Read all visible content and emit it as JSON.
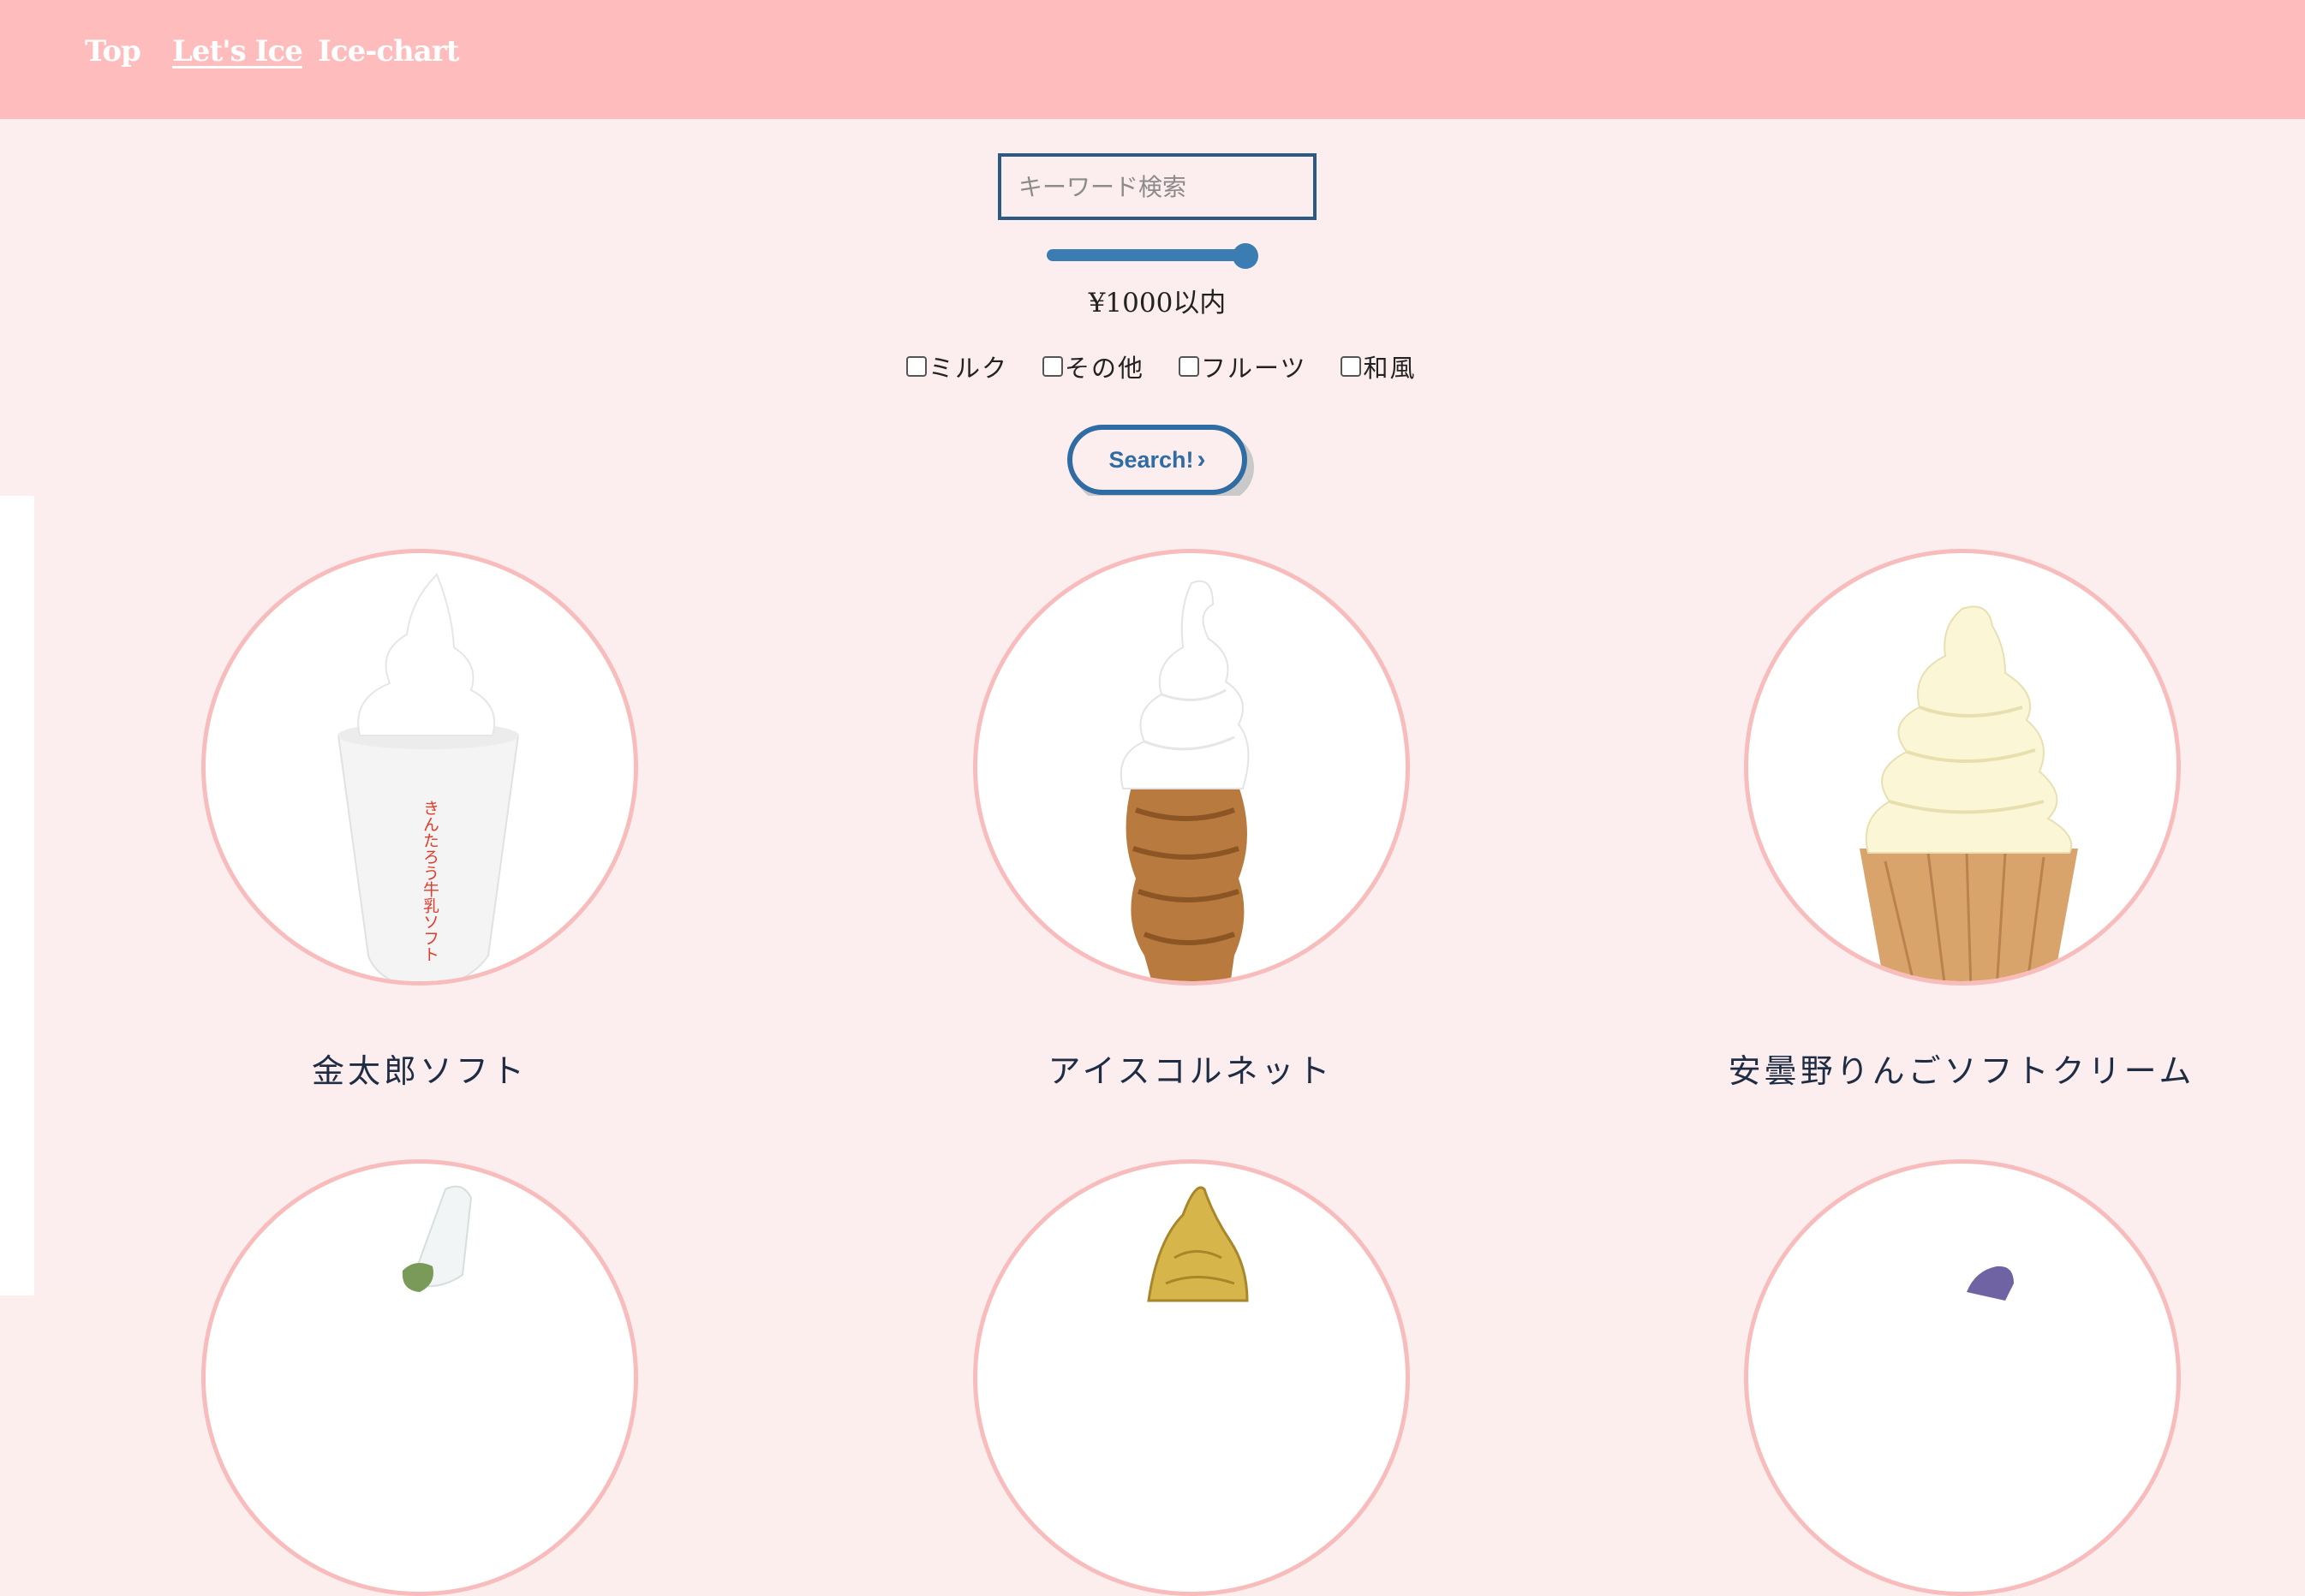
{
  "nav": {
    "items": [
      {
        "label": "Top"
      },
      {
        "label": "Let's Ice"
      },
      {
        "label": "Ice-chart"
      }
    ]
  },
  "search": {
    "placeholder": "キーワード検索",
    "price_label": "¥1000以内",
    "price_limit_fraction": 0.95,
    "filters": [
      {
        "label": "ミルク",
        "checked": false
      },
      {
        "label": "その他",
        "checked": false
      },
      {
        "label": "フルーツ",
        "checked": false
      },
      {
        "label": "和風",
        "checked": false
      }
    ],
    "button_label": "Search!",
    "button_icon": "chevron-right-icon"
  },
  "products": [
    {
      "name": "金太郎ソフト",
      "cup_text": "きんたろう牛乳ソフト"
    },
    {
      "name": "アイスコルネット"
    },
    {
      "name": "安曇野りんごソフトクリーム"
    }
  ],
  "colors": {
    "header": "#ffbcbc",
    "background": "#fcedee",
    "accent": "#2f6ca3",
    "circle_border": "#f8bcbc"
  }
}
